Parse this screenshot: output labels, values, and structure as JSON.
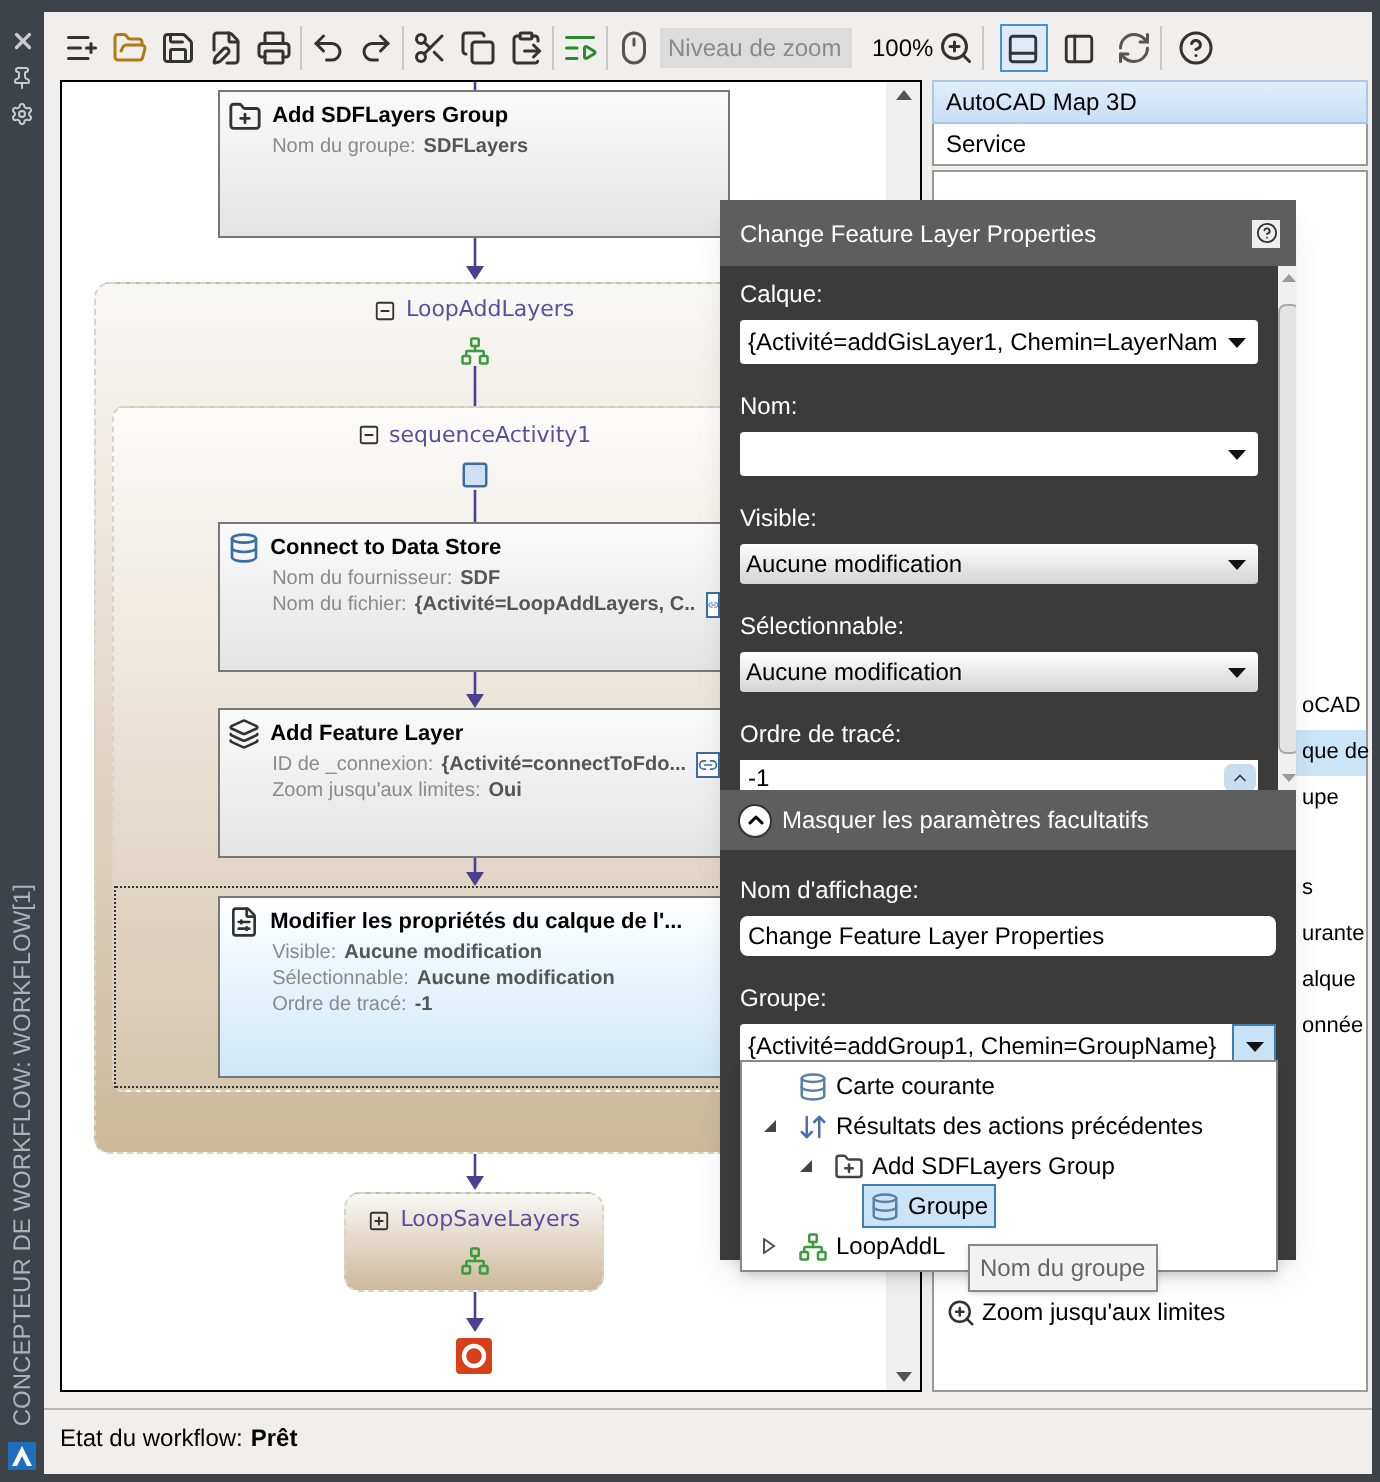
{
  "sidebar": {
    "title": "CONCEPTEUR DE WORKFLOW: WORKFLOW[1]"
  },
  "toolbar": {
    "zoom_placeholder": "Niveau de zoom",
    "zoom_value": "100%",
    "view_buttons": [
      {
        "pressed": true
      },
      {
        "pressed": false
      }
    ]
  },
  "workflow": {
    "top_activity": {
      "kind": "group",
      "title": "Add SDFLayers Group",
      "selected": false,
      "props": [
        {
          "label": "Nom du groupe:",
          "value": "SDFLayers",
          "bound": false
        }
      ]
    },
    "loop": {
      "title": "LoopAddLayers",
      "expanded": true,
      "sequence": {
        "title": "sequenceActivity1",
        "expanded": true,
        "activities": [
          {
            "kind": "connect",
            "title": "Connect to Data Store",
            "selected": false,
            "props": [
              {
                "label": "Nom du fournisseur:",
                "value": "SDF",
                "bound": false
              },
              {
                "label": "Nom du fichier:",
                "value": "{Activité=LoopAddLayers, C..",
                "bound": true
              }
            ]
          },
          {
            "kind": "layer",
            "title": "Add Feature Layer",
            "selected": false,
            "props": [
              {
                "label": "ID de _connexion:",
                "value": "{Activité=connectToFdo...",
                "bound": true
              },
              {
                "label": "Zoom jusqu'aux limites:",
                "value": "Oui",
                "bound": false
              }
            ]
          },
          {
            "kind": "properties",
            "title": "Modifier les propriétés du calque de l'...",
            "selected": true,
            "props": [
              {
                "label": "Visible:",
                "value": "Aucune modification",
                "bound": false
              },
              {
                "label": "Sélectionnable:",
                "value": "Aucune modification",
                "bound": false
              },
              {
                "label": "Ordre de tracé:",
                "value": "-1",
                "bound": false
              }
            ]
          }
        ]
      }
    },
    "after_loop": {
      "title": "LoopSaveLayers",
      "expanded": false
    }
  },
  "side_panel": {
    "header": "AutoCAD Map 3D",
    "subheader": "Service",
    "items": [
      {
        "text": "oCAD",
        "selected": false
      },
      {
        "text": "que de",
        "selected": true
      },
      {
        "text": "upe",
        "selected": false
      },
      {
        "text": "s",
        "selected": false
      },
      {
        "text": "urante",
        "selected": false
      },
      {
        "text": "alque",
        "selected": false
      },
      {
        "text": "onnée",
        "selected": false
      }
    ],
    "bottom_item": "Zoom jusqu'aux limites"
  },
  "dialog": {
    "title": "Change Feature Layer Properties",
    "fields": [
      {
        "label": "Calque:",
        "kind": "combo",
        "value": "{Activité=addGisLayer1, Chemin=LayerNam"
      },
      {
        "label": "Nom:",
        "kind": "combo"
      },
      {
        "label": "Visible:",
        "kind": "select",
        "value": "Aucune modification"
      },
      {
        "label": "Sélectionnable:",
        "kind": "select",
        "value": "Aucune modification"
      },
      {
        "label": "Ordre de tracé:",
        "kind": "spin",
        "value": "-1"
      }
    ],
    "optional": {
      "toggle": "Masquer les paramètres facultatifs",
      "expanded": true,
      "fields": [
        {
          "label": "Nom d'affichage:",
          "kind": "text",
          "value": "Change Feature Layer Properties"
        },
        {
          "label": "Groupe:",
          "kind": "combo",
          "value": "{Activité=addGroup1, Chemin=GroupName}",
          "open": true
        }
      ]
    },
    "dropdown": {
      "items": [
        {
          "kind": "map",
          "text": "Carte courante",
          "selected": false
        },
        {
          "kind": "results",
          "text": "Résultats des actions précédentes",
          "selected": false,
          "expanded": true,
          "children": [
            {
              "kind": "group",
              "text": "Add SDFLayers Group",
              "selected": false,
              "expanded": true,
              "children": [
                {
                  "kind": "map",
                  "text": "Groupe",
                  "selected": true
                }
              ]
            }
          ]
        },
        {
          "kind": "loop",
          "text": "LoopAddL",
          "selected": false,
          "expanded": false
        }
      ]
    },
    "tooltip": "Nom du groupe"
  },
  "status_bar": {
    "label": "Etat du workflow:",
    "value": "Prêt"
  }
}
